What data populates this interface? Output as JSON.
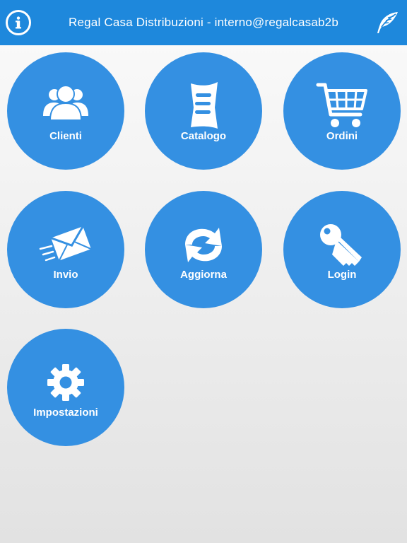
{
  "header": {
    "title": "Regal Casa Distribuzioni - interno@regalcasab2b",
    "left_icon": "info-icon",
    "right_icon": "feather-icon"
  },
  "colors": {
    "header_bg": "#1e88dc",
    "tile_bg": "#3490e2",
    "text": "#ffffff"
  },
  "menu": {
    "items": [
      {
        "label": "Clienti",
        "icon": "users-icon"
      },
      {
        "label": "Catalogo",
        "icon": "catalog-icon"
      },
      {
        "label": "Ordini",
        "icon": "cart-icon"
      },
      {
        "label": "Invio",
        "icon": "envelope-icon"
      },
      {
        "label": "Aggiorna",
        "icon": "refresh-icon"
      },
      {
        "label": "Login",
        "icon": "key-icon"
      },
      {
        "label": "Impostazioni",
        "icon": "gear-icon"
      }
    ]
  }
}
